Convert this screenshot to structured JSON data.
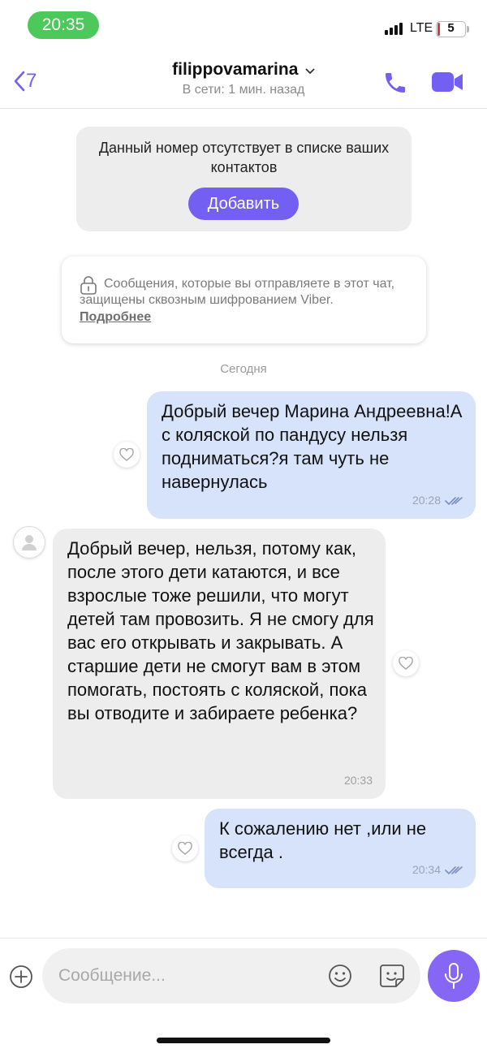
{
  "status_bar": {
    "time": "20:35",
    "network": "LTE",
    "battery_level": "5",
    "battery_percent": 5
  },
  "header": {
    "back_count": "7",
    "contact_name": "filippovamarina",
    "presence": "В сети: 1 мин. назад"
  },
  "unknown_contact": {
    "text": "Данный номер отсутствует в списке ваших контактов",
    "add_label": "Добавить"
  },
  "encryption_notice": {
    "text": "Сообщения, которые вы отправляете в этот чат, защищены сквозным шифрованием Viber.",
    "more_label": "Подробнее"
  },
  "day_separator": "Сегодня",
  "messages": [
    {
      "direction": "outgoing",
      "text": "Добрый вечер Марина Андреевна!А с коляской по пандусу нельзя подниматься?я там чуть не навернулась",
      "time": "20:28",
      "status": "read"
    },
    {
      "direction": "incoming",
      "text": "Добрый вечер,  нельзя,  потому как, после этого дети катаются, и все взрослые тоже решили, что могут детей там провозить. Я не смогу для вас его открывать и закрывать. А старшие дети не смогут вам в этом помогать, постоять с коляской, пока вы отводите и забираете ребенка?",
      "time": "20:33"
    },
    {
      "direction": "outgoing",
      "text": "К сожалению нет ,или не всегда .",
      "time": "20:34",
      "status": "read"
    }
  ],
  "composer": {
    "placeholder": "Сообщение..."
  },
  "colors": {
    "accent": "#7360f2",
    "outgoing_bubble": "#d7e3fb",
    "incoming_bubble": "#ededed",
    "status_pill": "#4cc95a"
  },
  "icons": [
    "back-chevron-icon",
    "phone-icon",
    "video-camera-icon",
    "lock-icon",
    "heart-icon",
    "double-check-icon",
    "plus-icon",
    "emoji-icon",
    "sticker-icon",
    "microphone-icon",
    "avatar-placeholder-icon"
  ]
}
